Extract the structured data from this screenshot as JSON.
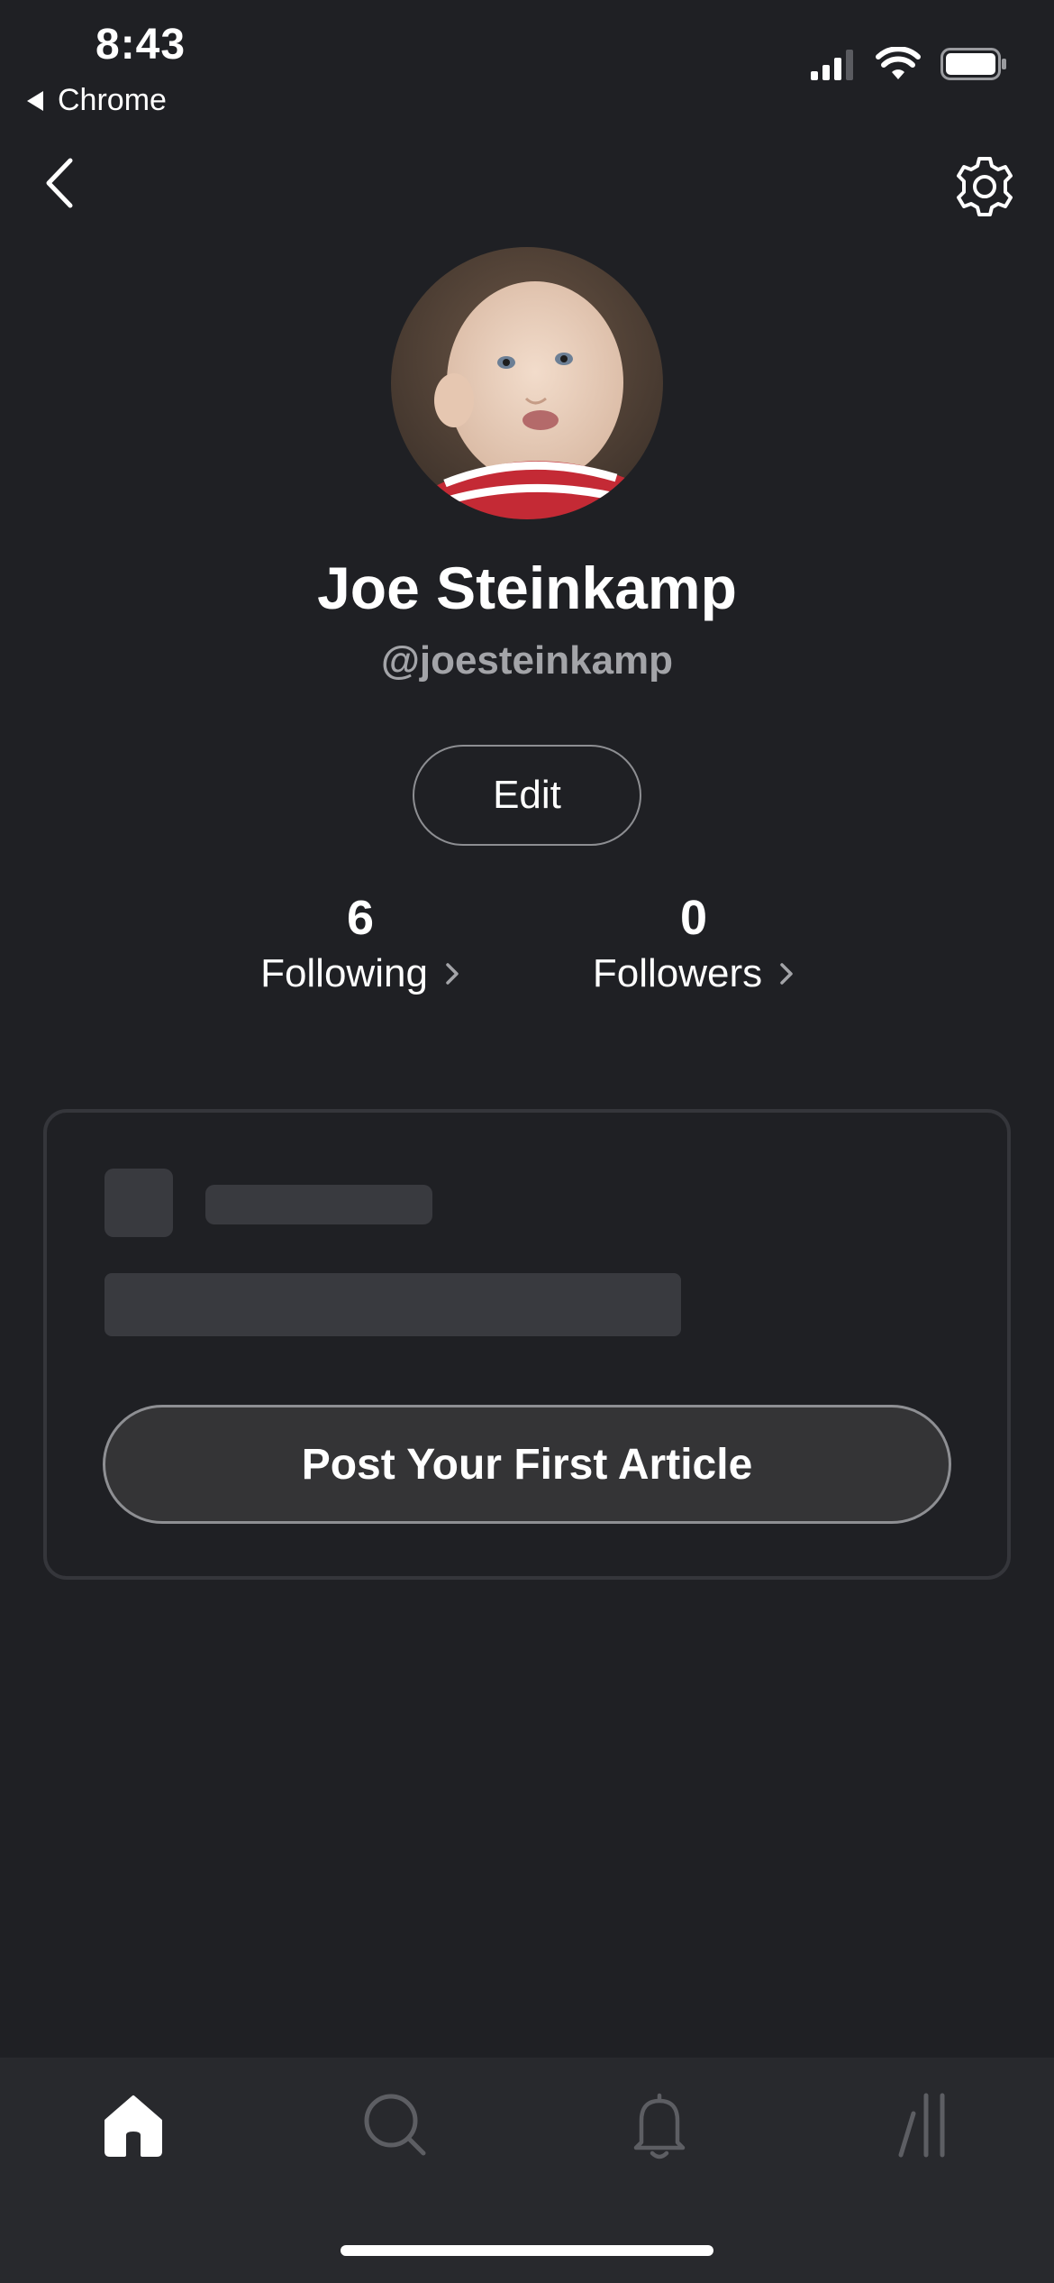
{
  "status_bar": {
    "time": "8:43",
    "back_app": "Chrome",
    "icons": [
      "signal-icon",
      "wifi-icon",
      "battery-icon"
    ]
  },
  "nav": {
    "back_icon": "chevron-left-icon",
    "settings_icon": "gear-icon"
  },
  "profile": {
    "name": "Joe Steinkamp",
    "handle": "@joesteinkamp",
    "edit_label": "Edit"
  },
  "stats": {
    "following_count": "6",
    "following_label": "Following",
    "followers_count": "0",
    "followers_label": "Followers"
  },
  "card": {
    "cta_label": "Post Your First Article"
  },
  "tabbar": {
    "items": [
      "home-icon",
      "search-icon",
      "bell-icon",
      "more-icon"
    ],
    "active": "home-icon"
  },
  "colors": {
    "background": "#1f2024",
    "tabbar": "#28292d",
    "skeleton": "#393a3f",
    "muted_text": "#a3a4a8",
    "inactive_icon": "#5d5e63"
  }
}
